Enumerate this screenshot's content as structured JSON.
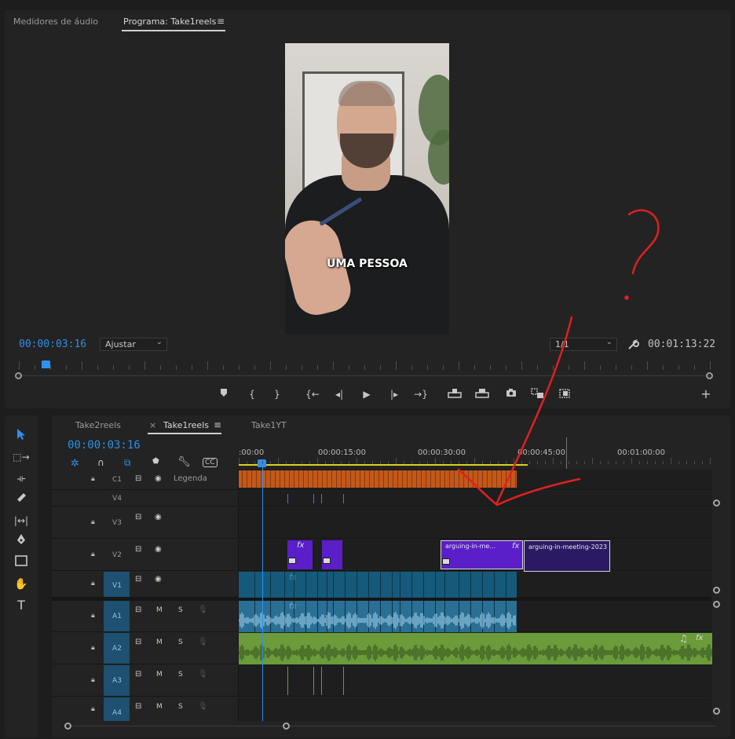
{
  "monitor": {
    "tabs": [
      {
        "label": "Medidores de áudio"
      },
      {
        "label": "Programa: Take1reels"
      }
    ],
    "menu_glyph": "≡",
    "video": {
      "caption": "UMA PESSOA"
    },
    "current_timecode": "00:00:03:16",
    "fit_dropdown": "Ajustar",
    "resolution_dropdown": "1/1",
    "duration_timecode": "00:01:13:22",
    "playhead_fraction": 0.04,
    "controls": [
      "add-marker",
      "mark-in",
      "mark-out",
      "go-to-in",
      "step-back",
      "play",
      "step-forward",
      "go-to-out",
      "lift",
      "extract",
      "export-frame",
      "insert",
      "overwrite",
      "add"
    ]
  },
  "timeline": {
    "tabs": [
      {
        "label": "Take2reels",
        "closable": false
      },
      {
        "label": "Take1reels",
        "closable": true
      },
      {
        "label": "Take1YT",
        "closable": false
      }
    ],
    "close_glyph": "×",
    "menu_glyph": "≡",
    "current_timecode": "00:00:03:16",
    "ruler_labels": [
      ":00:00",
      "00:00:15:00",
      "00:00:30:00",
      "00:00:45:00",
      "00:01:00:00"
    ],
    "caption_track": {
      "name": "C1",
      "label": "Legenda"
    },
    "video_tracks": [
      {
        "name": "V4"
      },
      {
        "name": "V3"
      },
      {
        "name": "V2"
      },
      {
        "name": "V1"
      }
    ],
    "audio_tracks": [
      {
        "name": "A1",
        "mute": "M",
        "solo": "S"
      },
      {
        "name": "A2",
        "mute": "M",
        "solo": "S"
      },
      {
        "name": "A3",
        "mute": "M",
        "solo": "S"
      },
      {
        "name": "A4",
        "mute": "M",
        "solo": "S"
      }
    ],
    "clips": {
      "v2_clip_a": {
        "label": "arguing-in-me...",
        "fx": "fx"
      },
      "v2_clip_b": {
        "label": "arguing-in-meeting-2023"
      },
      "v2_small_fx": "fx",
      "v1_fx": "fx",
      "a1_fx": "fx",
      "a2_fx": "fx",
      "a2_music": "♫"
    }
  },
  "tools": [
    "selection",
    "track-select-forward",
    "ripple-edit",
    "razor",
    "slip",
    "pen",
    "rectangle",
    "hand",
    "type"
  ],
  "annotation": {
    "color": "#e02020",
    "mark": "?"
  },
  "colors": {
    "accent_blue": "#2e8fe6",
    "caption_clip": "#c2581a",
    "v2_clip": "#5a1fc9",
    "v1_clip": "#155a7a",
    "a1_clip": "#2a6f94",
    "a2_clip": "#6b9b3a",
    "target_blue": "#1d5071"
  }
}
